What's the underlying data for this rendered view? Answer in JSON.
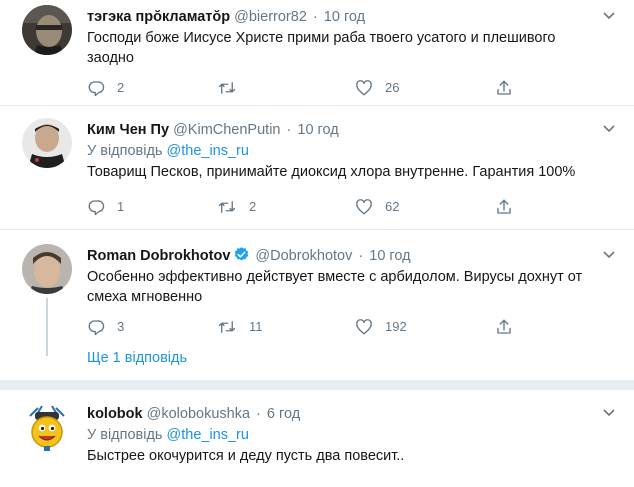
{
  "tweets": [
    {
      "name": "тэгэка прŏкламатŏр",
      "handle": "@bierror82",
      "dot": "·",
      "time": "10 год",
      "reply_prefix": "",
      "reply_to": "",
      "text_lines": [
        "Господи боже Иисусе Христе прими раба твоего усатого и плешивого",
        "заодно"
      ],
      "replies": "2",
      "retweets": "",
      "likes": "26",
      "verified": false
    },
    {
      "name": "Ким Чен Пу",
      "handle": "@KimChenPutin",
      "dot": "·",
      "time": "10 год",
      "reply_prefix": "У відповідь ",
      "reply_to": "@the_ins_ru",
      "text_lines": [
        "Товарищ Песков, принимайте диоксид хлора внутренне. Гарантия 100%"
      ],
      "replies": "1",
      "retweets": "2",
      "likes": "62",
      "verified": false
    },
    {
      "name": "Roman Dobrokhotov",
      "handle": "@Dobrokhotov",
      "dot": "·",
      "time": "10 год",
      "reply_prefix": "",
      "reply_to": "",
      "text_lines": [
        "Особенно эффективно действует вместе с арбидолом. Вирусы дохнут от",
        "смеха мгновенно"
      ],
      "replies": "3",
      "retweets": "11",
      "likes": "192",
      "verified": true
    },
    {
      "name": "kolobok",
      "handle": "@kolobokushka",
      "dot": "·",
      "time": "6 год",
      "reply_prefix": "У відповідь ",
      "reply_to": "@the_ins_ru",
      "text_lines": [
        "Быстрее окочурится и деду пусть два повесит.."
      ],
      "replies": "",
      "retweets": "",
      "likes": "",
      "verified": false
    }
  ],
  "show_more": "Ще 1 відповідь",
  "icons": {
    "reply": "reply-icon",
    "retweet": "retweet-icon",
    "like": "heart-icon",
    "share": "share-icon",
    "caret": "chevron-down-icon",
    "verified": "verified-badge-icon"
  },
  "colors": {
    "link": "#1b95e0",
    "secondary": "#657786",
    "divider": "#e6ecf0",
    "verified": "#1da1f2"
  }
}
